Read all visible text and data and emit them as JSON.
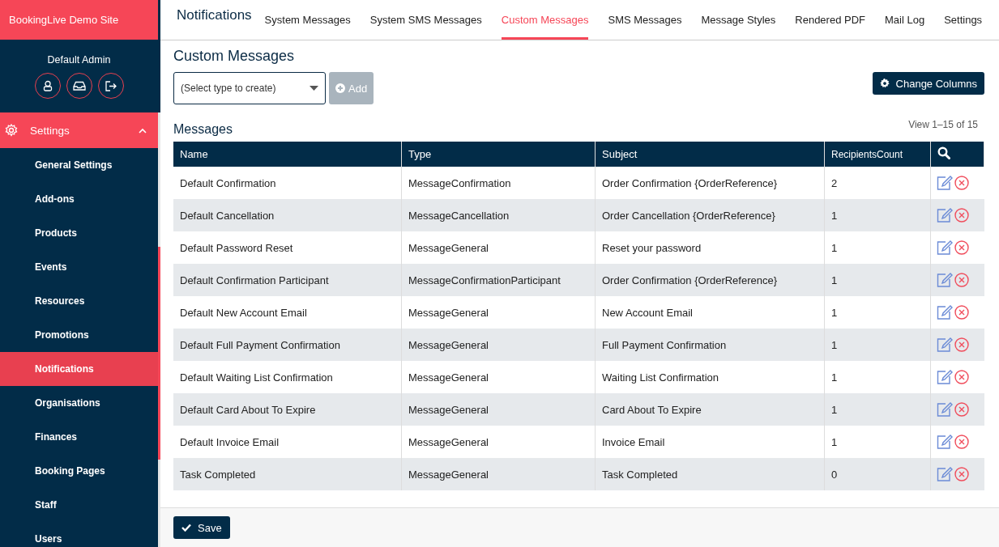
{
  "brand": "BookingLive Demo Site",
  "user": {
    "name": "Default Admin"
  },
  "sidebar": {
    "section": {
      "label": "Settings",
      "expanded": true
    },
    "items": [
      {
        "label": "General Settings",
        "selected": false
      },
      {
        "label": "Add-ons",
        "selected": false
      },
      {
        "label": "Products",
        "selected": false
      },
      {
        "label": "Events",
        "selected": false
      },
      {
        "label": "Resources",
        "selected": false
      },
      {
        "label": "Promotions",
        "selected": false
      },
      {
        "label": "Notifications",
        "selected": true
      },
      {
        "label": "Organisations",
        "selected": false
      },
      {
        "label": "Finances",
        "selected": false
      },
      {
        "label": "Booking Pages",
        "selected": false
      },
      {
        "label": "Staff",
        "selected": false
      },
      {
        "label": "Users",
        "selected": false
      }
    ]
  },
  "page_title": "Notifications",
  "tabs": [
    {
      "label": "System Messages",
      "selected": false
    },
    {
      "label": "System SMS Messages",
      "selected": false
    },
    {
      "label": "Custom Messages",
      "selected": true
    },
    {
      "label": "SMS Messages",
      "selected": false
    },
    {
      "label": "Message Styles",
      "selected": false
    },
    {
      "label": "Rendered PDF",
      "selected": false
    },
    {
      "label": "Mail Log",
      "selected": false
    },
    {
      "label": "Settings",
      "selected": false
    }
  ],
  "section_title": "Custom Messages",
  "type_select": {
    "value": "(Select type to create)"
  },
  "add_button": {
    "label": "Add",
    "disabled": true
  },
  "change_columns_button": "Change Columns",
  "table": {
    "title": "Messages",
    "pager": "View 1–15 of 15",
    "columns": [
      "Name",
      "Type",
      "Subject",
      "RecipientsCount"
    ],
    "rows": [
      [
        "Default Confirmation",
        "MessageConfirmation",
        "Order Confirmation {OrderReference}",
        "2"
      ],
      [
        "Default Cancellation",
        "MessageCancellation",
        "Order Cancellation {OrderReference}",
        "1"
      ],
      [
        "Default Password Reset",
        "MessageGeneral",
        "Reset your password",
        "1"
      ],
      [
        "Default Confirmation Participant",
        "MessageConfirmationParticipant",
        "Order Confirmation {OrderReference}",
        "1"
      ],
      [
        "Default New Account Email",
        "MessageGeneral",
        "New Account Email",
        "1"
      ],
      [
        "Default Full Payment Confirmation",
        "MessageGeneral",
        "Full Payment Confirmation",
        "1"
      ],
      [
        "Default Waiting List Confirmation",
        "MessageGeneral",
        "Waiting List Confirmation",
        "1"
      ],
      [
        "Default Card About To Expire",
        "MessageGeneral",
        "Card About To Expire",
        "1"
      ],
      [
        "Default Invoice Email",
        "MessageGeneral",
        "Invoice Email",
        "1"
      ],
      [
        "Task Completed",
        "MessageGeneral",
        "Task Completed",
        "0"
      ]
    ]
  },
  "save_button": "Save"
}
